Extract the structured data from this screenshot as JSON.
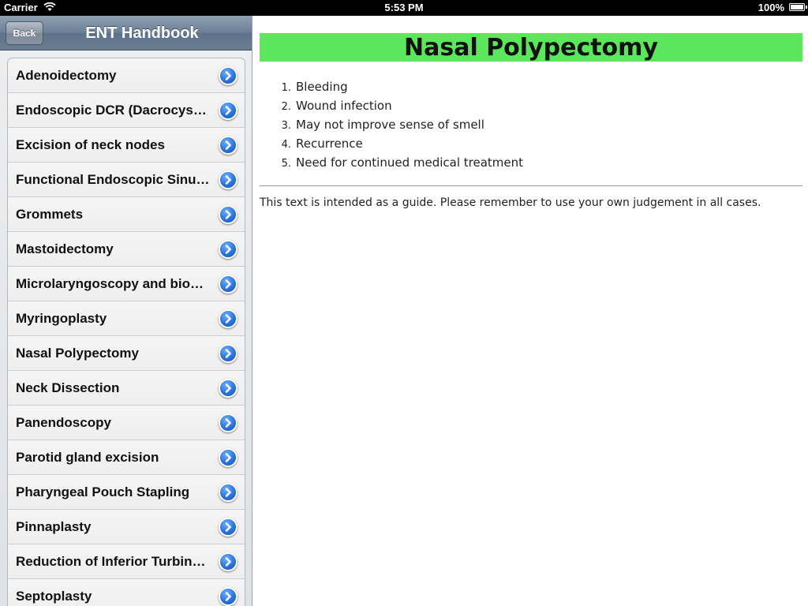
{
  "status_bar": {
    "carrier": "Carrier",
    "time": "5:53 PM",
    "battery": "100%"
  },
  "navbar": {
    "back_label": "Back",
    "title": "ENT Handbook"
  },
  "procedures": [
    "Adenoidectomy",
    "Endoscopic DCR (Dacrocys…",
    "Excision of neck nodes",
    "Functional Endoscopic Sinu…",
    "Grommets",
    "Mastoidectomy",
    "Microlaryngoscopy and bio…",
    "Myringoplasty",
    "Nasal Polypectomy",
    "Neck Dissection",
    "Panendoscopy",
    "Parotid gland excision",
    "Pharyngeal Pouch Stapling",
    "Pinnaplasty",
    "Reduction of Inferior Turbin…",
    "Septoplasty"
  ],
  "detail": {
    "title": "Nasal Polypectomy",
    "items": [
      {
        "num": "1.",
        "text": "Bleeding"
      },
      {
        "num": "2.",
        "text": "Wound infection"
      },
      {
        "num": "3.",
        "text": "May not improve sense of smell"
      },
      {
        "num": "4.",
        "text": "Recurrence"
      },
      {
        "num": "5.",
        "text": "Need for continued medical treatment"
      }
    ],
    "disclaimer": "This text is intended as a guide. Please remember to use your own judgement in all cases."
  },
  "colors": {
    "title_banner": "#5ce65c",
    "disclosure_blue": "#2a73d9",
    "navbar": "#6b7f95"
  }
}
